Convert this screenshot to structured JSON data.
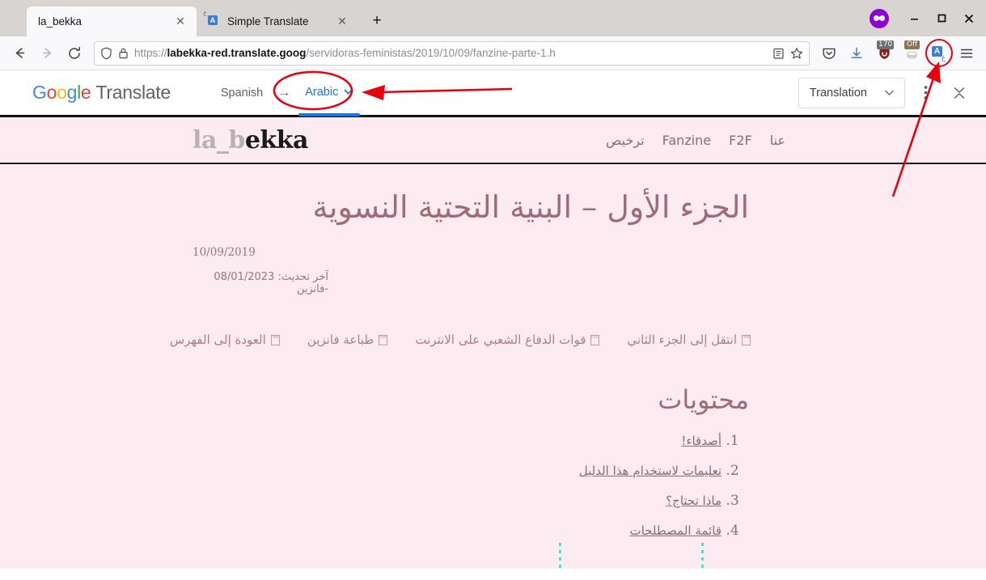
{
  "browser": {
    "tabs": [
      {
        "title": "la_bekka",
        "active": true,
        "favicon": "none",
        "close_label": "✕"
      },
      {
        "title": "Simple Translate",
        "active": false,
        "favicon": "simple-translate-icon",
        "close_label": "✕"
      }
    ],
    "new_tab_label": "+",
    "window_controls": {
      "minimize": "–",
      "maximize": "□",
      "close": "✕"
    },
    "container_icon": "purple-mask-icon",
    "nav": {
      "back": "←",
      "forward": "→",
      "reload": "⟳"
    },
    "url": {
      "scheme": "https://",
      "host": "labekka-red.translate.goog",
      "path": "/servidoras-feministas/2019/10/09/fanzine-parte-1.h",
      "shield_icon": "shield-icon",
      "lock_icon": "lock-icon",
      "reader_icon": "reader-view-icon",
      "bookmark_icon": "star-icon"
    },
    "toolbar": [
      {
        "name": "pocket-icon",
        "badge": null
      },
      {
        "name": "downloads-icon",
        "badge": null
      },
      {
        "name": "ublock-origin-icon",
        "badge": "170"
      },
      {
        "name": "cookie-autodelete-icon",
        "badge": "Off"
      },
      {
        "name": "simple-translate-icon",
        "badge": null,
        "highlighted": true
      },
      {
        "name": "hamburger-menu-icon",
        "badge": null
      }
    ]
  },
  "translate_bar": {
    "logo": {
      "google": "Google",
      "translate": "Translate"
    },
    "source_language": "Spanish",
    "arrow": "→",
    "target_language": "Arabic",
    "mode_select": "Translation",
    "more_options_icon": "kebab-menu-icon",
    "collapse_icon": "collapse-chevrons-icon"
  },
  "site": {
    "logo": {
      "faded": "la_b",
      "solid": "ekka"
    },
    "nav": [
      "عنا",
      "F2F",
      "Fanzine",
      "ترخيص"
    ]
  },
  "article": {
    "title": "الجزء الأول – البنية التحتية النسوية",
    "date": "10/09/2019",
    "updated": "آخر تحديث: 08/01/2023 -فانزين",
    "links": [
      {
        "label": "انتقل إلى الجزء الثاني",
        "glyph": "F06E"
      },
      {
        "label": "قوات الدفاع الشعبي على الانترنت",
        "glyph": "F15C"
      },
      {
        "label": "طباعة فانزين",
        "glyph": "F02F"
      },
      {
        "label": "العودة إلى الفهرس",
        "glyph": "F06E"
      }
    ],
    "toc_heading": "محتويات",
    "toc_items": [
      "أصدقاء!",
      "تعليمات لاستخدام هذا الدليل",
      "ماذا تحتاج؟",
      "قائمة المصطلحات"
    ]
  },
  "annotations": {
    "ellipse_target": "Arabic",
    "ellipse_target_2": "simple-translate-icon",
    "arrow_color": "#e8000d"
  },
  "colors": {
    "page_background": "#fcebf0",
    "accent_pink": "#9f6b76",
    "annotation_red": "#e8000d",
    "google_blue": "#1a73e8",
    "dash_marker": "#3ce8cf"
  }
}
